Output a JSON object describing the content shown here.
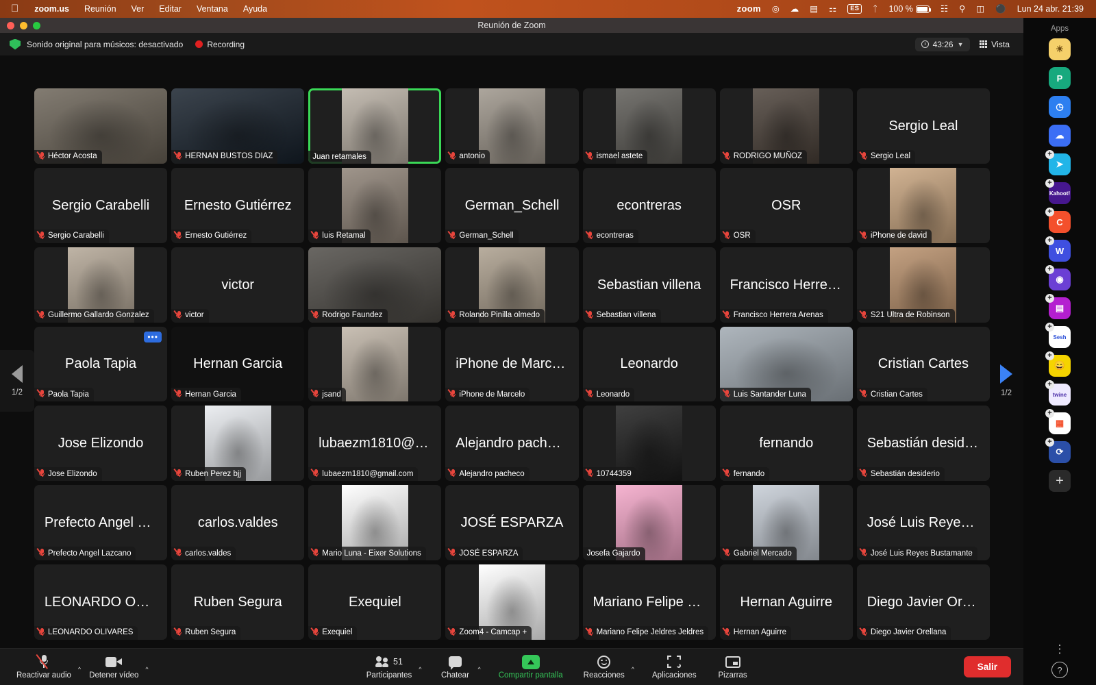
{
  "menubar": {
    "apple_icon": "apple-logo",
    "items": [
      "zoom.us",
      "Reunión",
      "Ver",
      "Editar",
      "Ventana",
      "Ayuda"
    ],
    "status": {
      "zoom_label": "zoom",
      "battery_percent": "100 %",
      "keyboard_lang": "ES",
      "clock": "Lun 24 abr.  21:39",
      "icons": [
        "record-indicator-icon",
        "time-machine-icon",
        "bed-icon",
        "keyboard-icon",
        "language-icon",
        "bluetooth-icon",
        "battery-icon",
        "wifi-icon",
        "search-icon",
        "control-center-icon",
        "siri-icon"
      ]
    }
  },
  "window": {
    "title": "Reunión de Zoom",
    "traffic_lights": [
      "close",
      "minimize",
      "zoom"
    ]
  },
  "subbar": {
    "original_sound": "Sonido original para músicos: desactivado",
    "recording_label": "Recording",
    "timer": "43:26",
    "view_label": "Vista"
  },
  "gallery": {
    "pager_left": {
      "label": "1/2",
      "icon": "chevron-left-icon"
    },
    "pager_right": {
      "label": "1/2",
      "icon": "chevron-right-icon"
    },
    "more_options_label": "•••",
    "tiles": [
      {
        "name": "Héctor Acosta",
        "video": true,
        "muted": true,
        "active": false,
        "bg": "#6b6357",
        "cover": true
      },
      {
        "name": "HERNAN BUSTOS DIAZ",
        "video": true,
        "muted": true,
        "active": false,
        "bg": "#16202b",
        "cover": true
      },
      {
        "name": "Juan retamales",
        "video": true,
        "muted": false,
        "active": true,
        "bg": "#b9b0a4",
        "cover": true,
        "partial": true
      },
      {
        "name": "antonio",
        "video": true,
        "muted": true,
        "active": false,
        "bg": "#9d958a",
        "cover": true,
        "partial": true
      },
      {
        "name": "ismael astete",
        "video": true,
        "muted": true,
        "active": false,
        "bg": "#5c5a55",
        "cover": true,
        "partial": true
      },
      {
        "name": "RODRIGO MUÑOZ",
        "video": true,
        "muted": true,
        "active": false,
        "bg": "#4a4038",
        "cover": true,
        "partial": true
      },
      {
        "name": "Sergio Leal",
        "video": false,
        "muted": true,
        "active": false
      },
      {
        "name": "Sergio Carabelli",
        "video": false,
        "muted": true,
        "active": false
      },
      {
        "name": "Ernesto Gutiérrez",
        "video": false,
        "muted": true,
        "active": false
      },
      {
        "name": "luis Retamal",
        "video": true,
        "muted": true,
        "active": false,
        "bg": "#8d8175",
        "partial": true
      },
      {
        "name": "German_Schell",
        "video": false,
        "muted": true,
        "active": false
      },
      {
        "name": "econtreras",
        "video": false,
        "muted": true,
        "active": false
      },
      {
        "name": "OSR",
        "video": false,
        "muted": true,
        "active": false
      },
      {
        "name": "iPhone de david",
        "video": true,
        "muted": true,
        "active": false,
        "bg": "#c8a47e",
        "partial": true
      },
      {
        "name": "Guillermo Gallardo Gonzalez",
        "video": true,
        "muted": true,
        "active": false,
        "bg": "#b3a695",
        "partial": true
      },
      {
        "name": "victor",
        "video": false,
        "muted": true,
        "active": false
      },
      {
        "name": "Rodrigo Faundez",
        "video": true,
        "muted": true,
        "active": false,
        "bg": "#4d4a45",
        "cover": true
      },
      {
        "name": "Rolando Pinilla olmedo",
        "video": true,
        "muted": true,
        "active": false,
        "bg": "#ab9e8c",
        "partial": true
      },
      {
        "name": "Sebastian villena",
        "video": false,
        "muted": true,
        "active": false
      },
      {
        "name": "Francisco Herrera Arenas",
        "video": false,
        "muted": true,
        "active": false,
        "display": "Francisco Herrera..."
      },
      {
        "name": "S21 Ultra de Robinson",
        "video": true,
        "muted": true,
        "active": false,
        "bg": "#b88f6a",
        "partial": true
      },
      {
        "name": "Paola Tapia",
        "video": false,
        "muted": true,
        "active": false,
        "menu": true
      },
      {
        "name": "Hernan Garcia",
        "video": false,
        "muted": true,
        "active": false,
        "dark": true
      },
      {
        "name": "jsand",
        "video": true,
        "muted": true,
        "active": false,
        "bg": "#bfb4a6",
        "partial": true
      },
      {
        "name": "iPhone de Marcelo",
        "video": false,
        "muted": true,
        "active": false
      },
      {
        "name": "Leonardo",
        "video": false,
        "muted": true,
        "active": false
      },
      {
        "name": "Luis Santander Luna",
        "video": true,
        "muted": true,
        "active": false,
        "bg": "#9fa8b0",
        "cover": true
      },
      {
        "name": "Cristian Cartes",
        "video": false,
        "muted": true,
        "active": false
      },
      {
        "name": "Jose Elizondo",
        "video": false,
        "muted": true,
        "active": false
      },
      {
        "name": "Ruben Perez bjj",
        "video": true,
        "muted": true,
        "active": false,
        "bg": "#e8ebef",
        "partial": true
      },
      {
        "name": "lubaezm1810@gmail.com",
        "video": false,
        "muted": true,
        "active": false,
        "display": "lubaezm1810@gm..."
      },
      {
        "name": "Alejandro pacheco",
        "video": false,
        "muted": true,
        "active": false
      },
      {
        "name": "10744359",
        "video": true,
        "muted": true,
        "active": false,
        "bg": "#1b1b1b",
        "partial": true
      },
      {
        "name": "fernando",
        "video": false,
        "muted": true,
        "active": false
      },
      {
        "name": "Sebastián desiderio",
        "video": false,
        "muted": true,
        "active": false
      },
      {
        "name": "Prefecto Angel Lazcano",
        "video": false,
        "muted": true,
        "active": false,
        "display": "Prefecto Angel Laz..."
      },
      {
        "name": "carlos.valdes",
        "video": false,
        "muted": true,
        "active": false
      },
      {
        "name": "Mario Luna - Eixer Solutions",
        "video": true,
        "muted": true,
        "active": false,
        "bg": "#ffffff",
        "partial": true
      },
      {
        "name": "JOSÉ ESPARZA",
        "video": false,
        "muted": true,
        "active": false
      },
      {
        "name": "Josefa Gajardo",
        "video": true,
        "muted": false,
        "active": false,
        "bg": "#f4a6c8",
        "partial": true
      },
      {
        "name": "Gabriel Mercado",
        "video": true,
        "muted": true,
        "active": false,
        "bg": "#c6cdd6",
        "partial": true
      },
      {
        "name": "José Luis Reyes Bustamante",
        "video": false,
        "muted": true,
        "active": false,
        "display": "José Luis Reyes B..."
      },
      {
        "name": "LEONARDO OLIVARES",
        "video": false,
        "muted": true,
        "active": false,
        "display": "LEONARDO OLIVA..."
      },
      {
        "name": "Ruben Segura",
        "video": false,
        "muted": true,
        "active": false
      },
      {
        "name": "Exequiel",
        "video": false,
        "muted": true,
        "active": false
      },
      {
        "name": "Zoom4 - Camcap +",
        "video": true,
        "muted": true,
        "active": false,
        "bg": "#ffffff",
        "partial": true
      },
      {
        "name": "Mariano Felipe Jeldres Jeldres",
        "video": false,
        "muted": true,
        "active": false,
        "display": "Mariano Felipe Jel..."
      },
      {
        "name": "Hernan Aguirre",
        "video": false,
        "muted": true,
        "active": false
      },
      {
        "name": "Diego Javier Orellana",
        "video": false,
        "muted": true,
        "active": false,
        "display": "Diego Javier Orella..."
      }
    ]
  },
  "toolbar": {
    "audio": {
      "label": "Reactivar audio",
      "icon": "mic-muted-icon",
      "caret": "^"
    },
    "video": {
      "label": "Detener vídeo",
      "icon": "camera-icon",
      "caret": "^"
    },
    "participants": {
      "label": "Participantes",
      "count": "51",
      "icon": "people-icon",
      "caret": "^"
    },
    "chat": {
      "label": "Chatear",
      "icon": "chat-bubble-icon",
      "caret": "^"
    },
    "share": {
      "label": "Compartir pantalla",
      "icon": "share-screen-icon"
    },
    "reactions": {
      "label": "Reacciones",
      "icon": "reactions-smiley-icon",
      "caret": "^"
    },
    "apps": {
      "label": "Aplicaciones",
      "icon": "apps-icon"
    },
    "whiteboards": {
      "label": "Pizarras",
      "icon": "whiteboard-icon"
    },
    "leave": {
      "label": "Salir"
    }
  },
  "dock": {
    "header": "Apps",
    "apps": [
      {
        "name": "poll-everywhere-app",
        "glyph": "☀",
        "bg": "#f5d06a",
        "fg": "#6b4a12",
        "badge": false
      },
      {
        "name": "padlet-app",
        "glyph": "P",
        "bg": "#17a97e",
        "fg": "#ffffff",
        "badge": false
      },
      {
        "name": "timer-app",
        "glyph": "◷",
        "bg": "#2d7ff0",
        "fg": "#ffffff",
        "badge": false
      },
      {
        "name": "attendance-app",
        "glyph": "☁",
        "bg": "#3b6ef5",
        "fg": "#ffffff",
        "badge": false
      },
      {
        "name": "pear-deck-app",
        "glyph": "➤",
        "bg": "#22b5e8",
        "fg": "#ffffff",
        "badge": true
      },
      {
        "name": "kahoot-app",
        "glyph": "Kahoot!",
        "bg": "#46178f",
        "fg": "#ffffff",
        "badge": true
      },
      {
        "name": "thinglink-app",
        "glyph": "C",
        "bg": "#f4502c",
        "fg": "#ffffff",
        "badge": true
      },
      {
        "name": "wooclap-app",
        "glyph": "W",
        "bg": "#3f4fe0",
        "fg": "#ffffff",
        "badge": true
      },
      {
        "name": "ai-assist-app",
        "glyph": "◉",
        "bg": "#6b3fd4",
        "fg": "#ffffff",
        "badge": true
      },
      {
        "name": "streaming-app",
        "glyph": "▤",
        "bg": "#b41fd0",
        "fg": "#ffffff",
        "badge": true
      },
      {
        "name": "sesh-app",
        "glyph": "Sesh",
        "bg": "#ffffff",
        "fg": "#2b4fd8",
        "badge": true
      },
      {
        "name": "emoji-app",
        "glyph": "😄",
        "bg": "#f5d400",
        "fg": "#333333",
        "badge": true
      },
      {
        "name": "twine-app",
        "glyph": "twine",
        "bg": "#eeeaff",
        "fg": "#4b2fa8",
        "badge": true
      },
      {
        "name": "tiles-app",
        "glyph": "▦",
        "bg": "#ffffff",
        "fg": "#f4502c",
        "badge": true
      },
      {
        "name": "sync-app",
        "glyph": "⟳",
        "bg": "#2b4fa8",
        "fg": "#ffffff",
        "badge": true
      }
    ],
    "add_label": "+",
    "more_label": "⋮",
    "help_label": "?"
  }
}
